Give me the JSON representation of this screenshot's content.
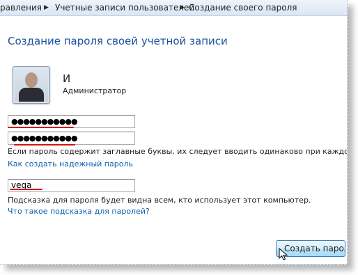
{
  "breadcrumb": {
    "items": [
      {
        "label": "равления"
      },
      {
        "label": "Учетные записи пользователей"
      },
      {
        "label": "Создание своего пароля"
      }
    ],
    "separator": "▶"
  },
  "page": {
    "title": "Создание пароля своей учетной записи"
  },
  "user": {
    "name": "И",
    "role": "Администратор"
  },
  "form": {
    "new_password": "●●●●●●●●●●●",
    "confirm_password": "●●●●●●●●●●●",
    "case_warning": "Если пароль содержит заглавные буквы, их следует вводить одинаково при каждом вхо",
    "strong_password_link": "Как создать надежный пароль",
    "hint_value": "vega",
    "hint_visibility_note": "Подсказка для пароля будет видна всем, кто использует этот компьютер.",
    "hint_help_link": "Что такое подсказка для паролей?"
  },
  "actions": {
    "create_button": "Создать пароль"
  },
  "annotation_color": "#d01414",
  "icons": {
    "breadcrumb_separator": "chevron-right-icon",
    "cursor": "mouse-pointer-icon"
  }
}
